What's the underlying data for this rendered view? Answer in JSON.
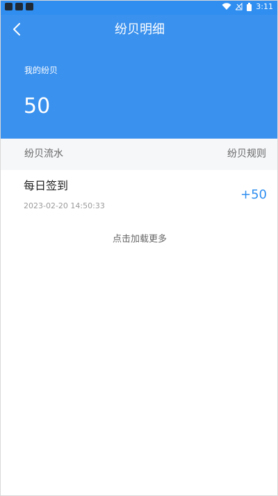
{
  "status_bar": {
    "time": "3:11",
    "icons": [
      "wifi-icon",
      "no-signal-icon",
      "battery-icon"
    ]
  },
  "header": {
    "title": "纷贝明细",
    "back_icon": "chevron-left-icon",
    "balance_label": "我的纷贝",
    "balance_value": "50"
  },
  "section": {
    "left_label": "纷贝流水",
    "right_label": "纷贝规则"
  },
  "records": [
    {
      "title": "每日签到",
      "time": "2023-02-20 14:50:33",
      "amount": "+50"
    }
  ],
  "load_more": "点击加载更多",
  "colors": {
    "primary": "#3a91ee",
    "accent": "#2f8ef0",
    "section_bg": "#f6f7f9"
  }
}
